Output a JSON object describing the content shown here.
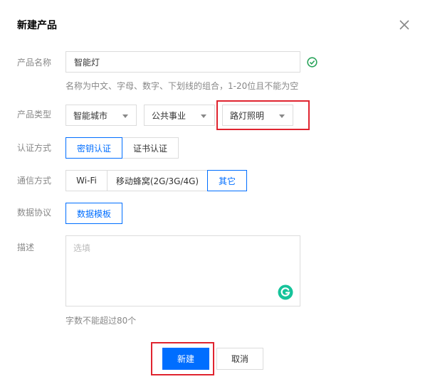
{
  "dialog": {
    "title": "新建产品",
    "close_icon": "close-icon"
  },
  "form": {
    "name": {
      "label": "产品名称",
      "value": "智能灯",
      "hint": "名称为中文、字母、数字、下划线的组合，1-20位且不能为空",
      "status_icon": "check-circle-icon",
      "status_color": "#29a35a"
    },
    "type": {
      "label": "产品类型",
      "selects": [
        "智能城市",
        "公共事业",
        "路灯照明"
      ]
    },
    "auth": {
      "label": "认证方式",
      "options": [
        "密钥认证",
        "证书认证"
      ],
      "selected": "密钥认证"
    },
    "comm": {
      "label": "通信方式",
      "options": [
        "Wi-Fi",
        "移动蜂窝(2G/3G/4G)",
        "其它"
      ],
      "selected": "其它"
    },
    "protocol": {
      "label": "数据协议",
      "button": "数据模板"
    },
    "desc": {
      "label": "描述",
      "placeholder": "选填",
      "hint": "字数不能超过80个",
      "grammarly_icon": "grammarly-icon",
      "grammarly_color": "#15c39a"
    }
  },
  "footer": {
    "confirm": "新建",
    "cancel": "取消"
  },
  "colors": {
    "accent": "#006eff",
    "highlight": "#e0242f"
  }
}
